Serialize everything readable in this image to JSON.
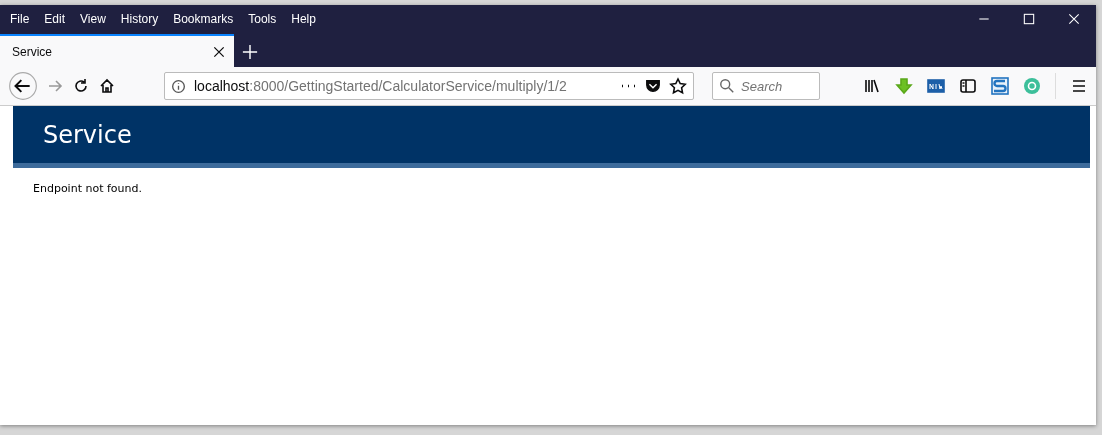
{
  "menu": [
    "File",
    "Edit",
    "View",
    "History",
    "Bookmarks",
    "Tools",
    "Help"
  ],
  "tabs": [
    {
      "label": "Service",
      "selected": true
    }
  ],
  "address": {
    "host": "localhost",
    "path": ":8000/GettingStarted/CalculatorService/multiply/1/2"
  },
  "search": {
    "placeholder": "Search"
  },
  "page": {
    "header": "Service",
    "message": "Endpoint not found."
  }
}
